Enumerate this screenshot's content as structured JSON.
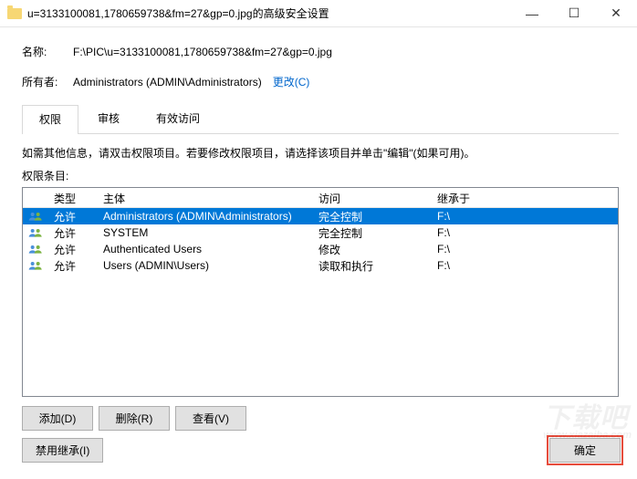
{
  "window": {
    "title": "u=3133100081,1780659738&fm=27&gp=0.jpg的高级安全设置"
  },
  "fields": {
    "name_label": "名称:",
    "name_value": "F:\\PIC\\u=3133100081,1780659738&fm=27&gp=0.jpg",
    "owner_label": "所有者:",
    "owner_value": "Administrators (ADMIN\\Administrators)",
    "change_link": "更改(C)"
  },
  "tabs": {
    "perm": "权限",
    "audit": "审核",
    "effective": "有效访问"
  },
  "instruction": "如需其他信息，请双击权限项目。若要修改权限项目，请选择该项目并单击\"编辑\"(如果可用)。",
  "entries_label": "权限条目:",
  "columns": {
    "type": "类型",
    "principal": "主体",
    "access": "访问",
    "inherited": "继承于"
  },
  "entries": [
    {
      "type": "允许",
      "principal": "Administrators (ADMIN\\Administrators)",
      "access": "完全控制",
      "inherited": "F:\\"
    },
    {
      "type": "允许",
      "principal": "SYSTEM",
      "access": "完全控制",
      "inherited": "F:\\"
    },
    {
      "type": "允许",
      "principal": "Authenticated Users",
      "access": "修改",
      "inherited": "F:\\"
    },
    {
      "type": "允许",
      "principal": "Users (ADMIN\\Users)",
      "access": "读取和执行",
      "inherited": "F:\\"
    }
  ],
  "buttons": {
    "add": "添加(D)",
    "remove": "删除(R)",
    "view": "查看(V)",
    "disable_inherit": "禁用继承(I)",
    "ok": "确定"
  },
  "watermark": {
    "main": "下载吧",
    "sub": "www.xiazaiba.com"
  }
}
